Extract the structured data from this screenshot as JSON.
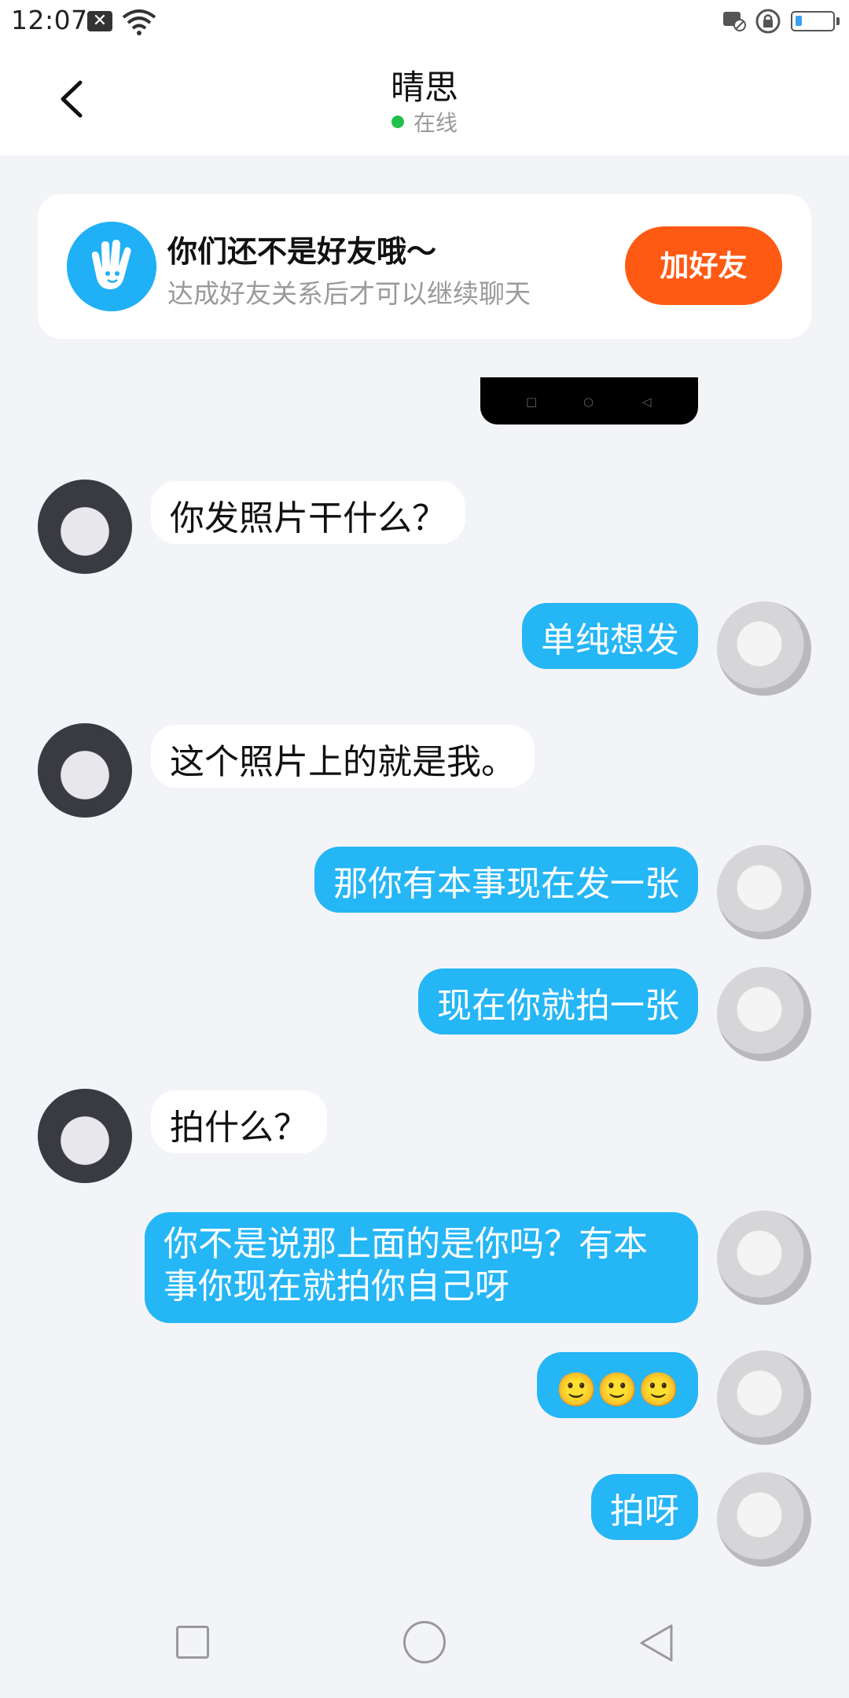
{
  "status_bar": {
    "time": "12:07"
  },
  "header": {
    "title": "晴思",
    "status": "在线"
  },
  "friend_card": {
    "title": "你们还不是好友哦～",
    "subtitle": "达成好友关系后才可以继续聊天",
    "button": "加好友"
  },
  "messages": [
    {
      "sender": "other",
      "text": "你发照片干什么？"
    },
    {
      "sender": "self",
      "text": "单纯想发"
    },
    {
      "sender": "other",
      "text": "这个照片上的就是我。"
    },
    {
      "sender": "self",
      "text": "那你有本事现在发一张"
    },
    {
      "sender": "self",
      "text": "现在你就拍一张"
    },
    {
      "sender": "other",
      "text": "拍什么？"
    },
    {
      "sender": "self",
      "text": "你不是说那上面的是你吗？有本事你现在就拍你自己呀"
    },
    {
      "sender": "self",
      "text": "🙂🙂🙂"
    },
    {
      "sender": "self",
      "text": "拍呀"
    }
  ]
}
